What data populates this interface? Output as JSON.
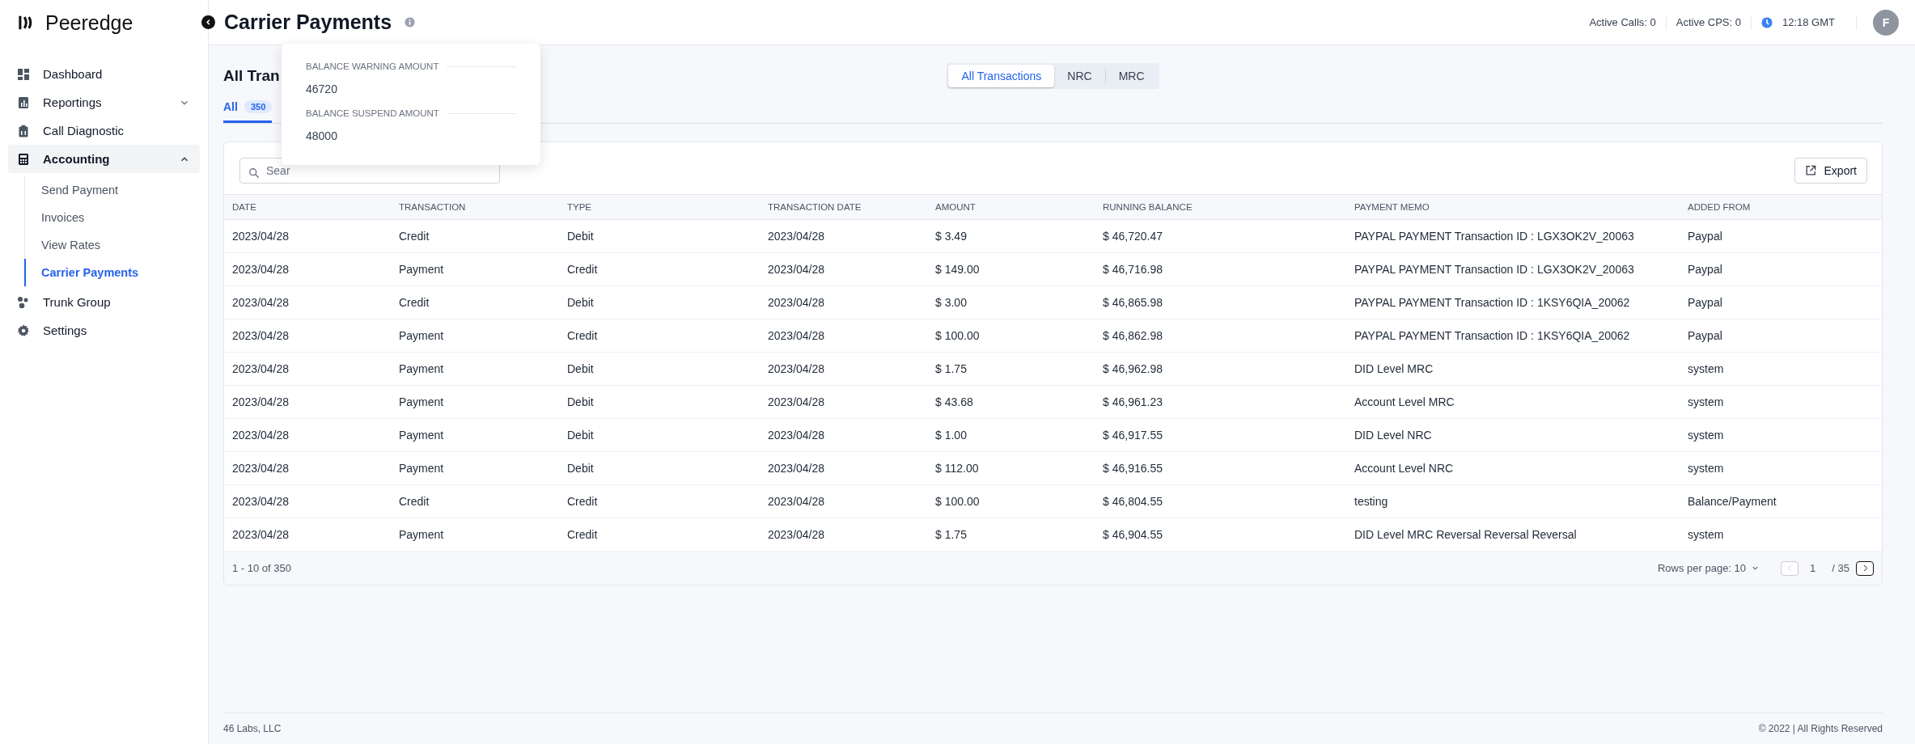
{
  "app": {
    "logo": "Peeredge"
  },
  "sidebar": {
    "items": [
      {
        "label": "Dashboard",
        "selected": false
      },
      {
        "label": "Reportings",
        "selected": false,
        "expanded": false
      },
      {
        "label": "Call Diagnostic",
        "selected": false
      },
      {
        "label": "Accounting",
        "selected": true,
        "expanded": true,
        "children": [
          {
            "label": "Send Payment",
            "selected": false
          },
          {
            "label": "Invoices",
            "selected": false
          },
          {
            "label": "View Rates",
            "selected": false
          },
          {
            "label": "Carrier Payments",
            "selected": true
          }
        ]
      },
      {
        "label": "Trunk Group",
        "selected": false
      },
      {
        "label": "Settings",
        "selected": false
      }
    ]
  },
  "header": {
    "title": "Carrier Payments",
    "stats": [
      "Active Calls: 0",
      "Active CPS: 0"
    ],
    "time": "12:18 GMT",
    "avatar": "F"
  },
  "popover": {
    "fields": [
      {
        "label": "BALANCE WARNING AMOUNT",
        "value": "46720"
      },
      {
        "label": "BALANCE SUSPEND AMOUNT",
        "value": "48000"
      }
    ]
  },
  "content": {
    "heading": "All Tran",
    "segments": [
      {
        "label": "All Transactions",
        "selected": true
      },
      {
        "label": "NRC",
        "selected": false
      },
      {
        "label": "MRC",
        "selected": false
      }
    ],
    "tabs": [
      {
        "label": "All",
        "count": "350",
        "selected": true
      }
    ]
  },
  "table": {
    "search_placeholder": "Sear",
    "export": "Export",
    "columns": [
      "DATE",
      "TRANSACTION",
      "TYPE",
      "TRANSACTION DATE",
      "AMOUNT",
      "RUNNING BALANCE",
      "PAYMENT MEMO",
      "ADDED FROM"
    ],
    "rows": [
      [
        "2023/04/28",
        "Credit",
        "Debit",
        "2023/04/28",
        "$ 3.49",
        "$ 46,720.47",
        "PAYPAL PAYMENT Transaction ID : LGX3OK2V_20063",
        "Paypal"
      ],
      [
        "2023/04/28",
        "Payment",
        "Credit",
        "2023/04/28",
        "$ 149.00",
        "$ 46,716.98",
        "PAYPAL PAYMENT Transaction ID : LGX3OK2V_20063",
        "Paypal"
      ],
      [
        "2023/04/28",
        "Credit",
        "Debit",
        "2023/04/28",
        "$ 3.00",
        "$ 46,865.98",
        "PAYPAL PAYMENT Transaction ID : 1KSY6QIA_20062",
        "Paypal"
      ],
      [
        "2023/04/28",
        "Payment",
        "Credit",
        "2023/04/28",
        "$ 100.00",
        "$ 46,862.98",
        "PAYPAL PAYMENT Transaction ID : 1KSY6QIA_20062",
        "Paypal"
      ],
      [
        "2023/04/28",
        "Payment",
        "Debit",
        "2023/04/28",
        "$ 1.75",
        "$ 46,962.98",
        "DID Level MRC",
        "system"
      ],
      [
        "2023/04/28",
        "Payment",
        "Debit",
        "2023/04/28",
        "$ 43.68",
        "$ 46,961.23",
        "Account Level MRC",
        "system"
      ],
      [
        "2023/04/28",
        "Payment",
        "Debit",
        "2023/04/28",
        "$ 1.00",
        "$ 46,917.55",
        "DID Level NRC",
        "system"
      ],
      [
        "2023/04/28",
        "Payment",
        "Debit",
        "2023/04/28",
        "$ 112.00",
        "$ 46,916.55",
        "Account Level NRC",
        "system"
      ],
      [
        "2023/04/28",
        "Credit",
        "Credit",
        "2023/04/28",
        "$ 100.00",
        "$ 46,804.55",
        "testing",
        "Balance/Payment"
      ],
      [
        "2023/04/28",
        "Payment",
        "Credit",
        "2023/04/28",
        "$ 1.75",
        "$ 46,904.55",
        "DID Level MRC Reversal Reversal Reversal",
        "system"
      ]
    ],
    "summary": "1 - 10 of 350",
    "rows_per_page": "Rows per page: 10",
    "page": "1",
    "pages": "/ 35",
    "prev_disabled": true,
    "next_disabled": false
  },
  "footer": {
    "left": "46 Labs, LLC",
    "right": "© 2022 | All Rights Reserved"
  }
}
